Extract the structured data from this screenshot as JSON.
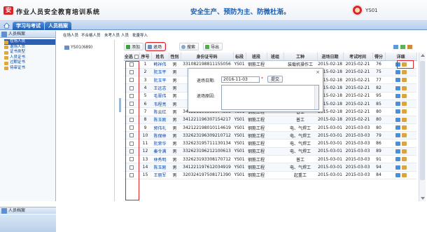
{
  "header": {
    "app_title": "作业人员安全教育培训系统",
    "slogan": "安全生产、预防为主、防微杜渐。",
    "username": "YS01"
  },
  "nav_tabs": [
    "学习与考试",
    "人员档案"
  ],
  "sidebar": {
    "title": "人员档案",
    "items": [
      "在场人员",
      "退场人员",
      "证书类型",
      "人员证书",
      "过期证书",
      "待审证书"
    ],
    "bottom_title": "人员档案"
  },
  "inner_tabs": [
    "在场人员",
    "不合格人员",
    "未考人员",
    "人员",
    "批量导入"
  ],
  "org_tree": {
    "root": "YS01(689)"
  },
  "toolbar": {
    "add": "添加",
    "exit": "退场",
    "search": "搜索",
    "export": "导出"
  },
  "table": {
    "headers": [
      "全选",
      "序号",
      "姓名",
      "性别",
      "身份证号码",
      "标段",
      "班段",
      "班组",
      "工种",
      "进场日期",
      "考试时间",
      "得分",
      "详细"
    ],
    "rows": [
      [
        "1",
        "韩祥伟",
        "男",
        "331082198811155056",
        "YS01",
        "钢筋工程",
        "",
        "装载机操作工",
        "2015-02-18",
        "2015-02-21",
        "76"
      ],
      [
        "2",
        "阮玉平",
        "男",
        "",
        "",
        "",
        "",
        "",
        "2015-02-18",
        "2015-02-21",
        "75"
      ],
      [
        "3",
        "阮玉平",
        "男",
        "",
        "",
        "",
        "",
        "",
        "2015-02-18",
        "2015-02-21",
        "77"
      ],
      [
        "4",
        "王远志",
        "男",
        "",
        "",
        "",
        "",
        "",
        "2015-02-18",
        "2015-02-21",
        "82"
      ],
      [
        "5",
        "毛翠伟",
        "男",
        "",
        "",
        "",
        "",
        "",
        "2015-02-18",
        "2015-02-21",
        "95"
      ],
      [
        "6",
        "韦程亮",
        "男",
        "",
        "",
        "",
        "",
        "",
        "2015-02-18",
        "2015-02-21",
        "85"
      ],
      [
        "7",
        "陈云红",
        "男",
        "341221196305074895",
        "YS01",
        "钢筋工程",
        "",
        "普工",
        "2015-02-18",
        "2015-02-21",
        "80"
      ],
      [
        "8",
        "陈玉刚",
        "男",
        "341221196307154217",
        "YS01",
        "钢筋工程",
        "",
        "普工",
        "2015-02-18",
        "2015-02-21",
        "80"
      ],
      [
        "9",
        "郭伟礼",
        "男",
        "342122198010114619",
        "YS01",
        "钢筋工程",
        "",
        "电、气焊工",
        "2015-03-01",
        "2015-03-03",
        "80"
      ],
      [
        "10",
        "陈保林",
        "男",
        "332623196309210712",
        "YS01",
        "钢筋工程",
        "",
        "电、气焊工",
        "2015-03-01",
        "2015-03-03",
        "79"
      ],
      [
        "11",
        "阮荣华",
        "男",
        "332623195711130134",
        "YS01",
        "钢筋工程",
        "",
        "电、气焊工",
        "2015-03-01",
        "2015-03-03",
        "86"
      ],
      [
        "12",
        "秦令满",
        "男",
        "332623196212100613",
        "YS01",
        "钢筋工程",
        "",
        "电、气焊工",
        "2015-03-01",
        "2015-03-03",
        "89"
      ],
      [
        "13",
        "林秀明",
        "男",
        "332623193308170712",
        "YS01",
        "钢筋工程",
        "",
        "普工",
        "2015-03-01",
        "2015-03-03",
        "91"
      ],
      [
        "14",
        "陈玉刚",
        "男",
        "341221197612034919",
        "YS01",
        "钢筋工程",
        "",
        "电、气焊工",
        "2015-03-01",
        "2015-03-03",
        "94"
      ],
      [
        "15",
        "王丽军",
        "男",
        "320324197508171390",
        "YS01",
        "钢筋工程",
        "",
        "起重工",
        "2015-03-01",
        "2015-03-03",
        "84"
      ]
    ]
  },
  "dialog": {
    "date_label": "退场日期:",
    "date_value": "2016-11-03",
    "required_mark": "*",
    "submit": "提交",
    "reason_label": "退场原因:",
    "close": "×"
  },
  "colors": {
    "accent_blue": "#1b5fb0",
    "highlight_red": "#e0222b",
    "link_blue": "#0645ad"
  }
}
